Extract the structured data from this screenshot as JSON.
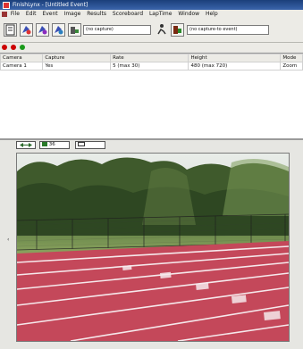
{
  "window": {
    "title": "FinishLynx - [Untitled Event]"
  },
  "menu": [
    "File",
    "Edit",
    "Event",
    "Image",
    "Results",
    "Scoreboard",
    "LapTime",
    "Window",
    "Help"
  ],
  "toolbar": {
    "combo1": "(no capture)",
    "combo2": "(no capture-to event)"
  },
  "icons_row_text": "",
  "table": {
    "headers": [
      "Camera",
      "Capture",
      "Rate",
      "Height",
      "Mode"
    ],
    "rows": [
      [
        "Camera 1",
        "Yes",
        "5 (max 30)",
        "480 (max 720)",
        "Zoom"
      ]
    ]
  },
  "zoom": {
    "value": "36",
    "label": ""
  },
  "colors": {
    "title_bar": "#2a5294",
    "track": "#c4485a"
  }
}
